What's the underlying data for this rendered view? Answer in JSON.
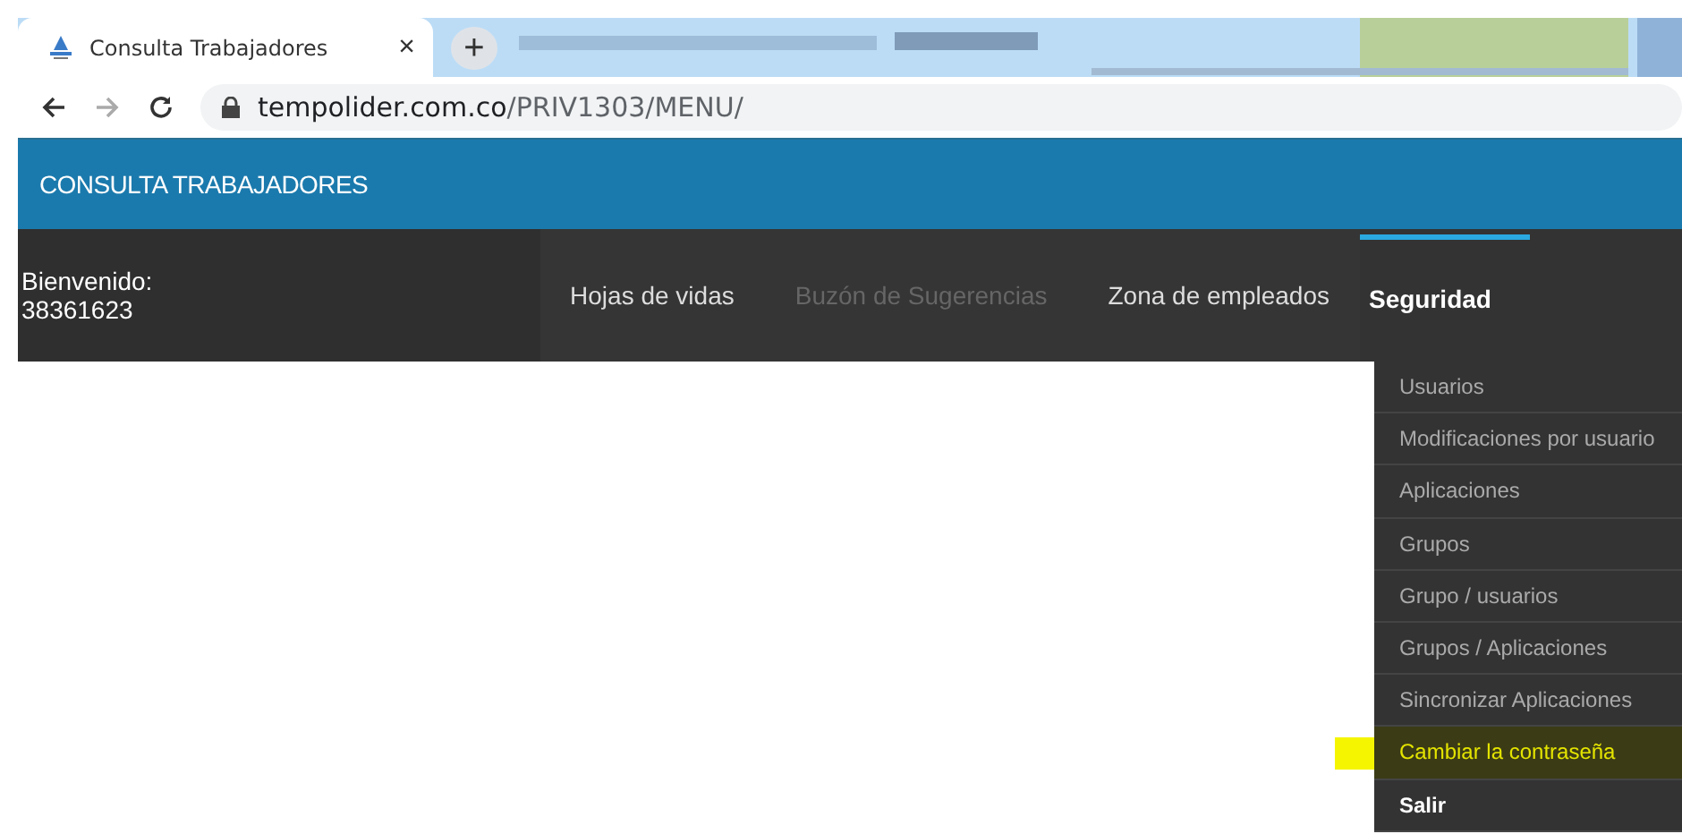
{
  "browser": {
    "tab": {
      "title": "Consulta Trabajadores",
      "close": "×"
    },
    "new_tab": "+",
    "url_host": "tempolider.com.co",
    "url_path": "/PRIV1303/MENU/"
  },
  "header": {
    "title": "CONSULTA TRABAJADORES"
  },
  "welcome": {
    "label": "Bienvenido:",
    "user": "38361623"
  },
  "nav": [
    {
      "label": "Hojas de vidas",
      "selected": false,
      "disabled": false
    },
    {
      "label": "Buzón de Sugerencias",
      "selected": false,
      "disabled": true
    },
    {
      "label": "Zona de empleados",
      "selected": false,
      "disabled": false
    },
    {
      "label": "Seguridad",
      "selected": true,
      "disabled": false
    }
  ],
  "dropdown": [
    {
      "label": "Usuarios",
      "highlighted": false,
      "emphasized": false
    },
    {
      "label": "Modificaciones por usuario",
      "highlighted": false,
      "emphasized": false
    },
    {
      "label": "Aplicaciones",
      "highlighted": false,
      "emphasized": false
    },
    {
      "label": "Grupos",
      "highlighted": false,
      "emphasized": false
    },
    {
      "label": "Grupo / usuarios",
      "highlighted": false,
      "emphasized": false
    },
    {
      "label": "Grupos / Aplicaciones",
      "highlighted": false,
      "emphasized": false
    },
    {
      "label": "Sincronizar Aplicaciones",
      "highlighted": false,
      "emphasized": false
    },
    {
      "label": "Cambiar la contraseña",
      "highlighted": true,
      "emphasized": false
    },
    {
      "label": "Salir",
      "highlighted": false,
      "emphasized": true
    }
  ]
}
